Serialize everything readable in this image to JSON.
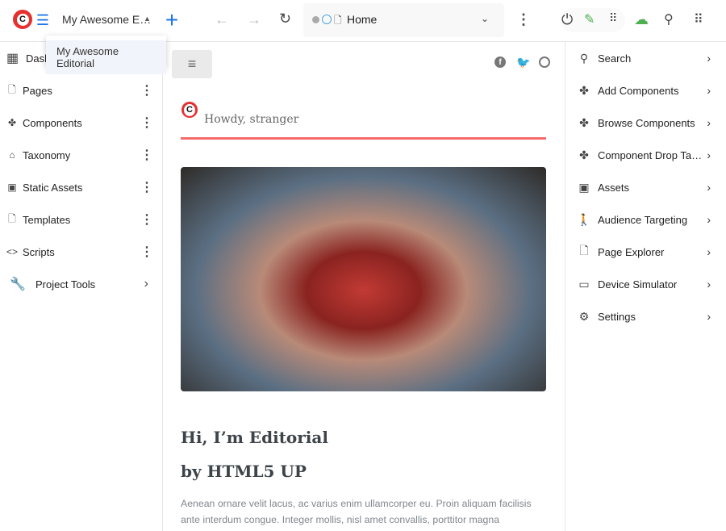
{
  "topbar": {
    "site_name": "My Awesome E…",
    "address": "Home",
    "logo_letter": "C"
  },
  "dropdown": {
    "items": [
      "My Awesome Editorial"
    ]
  },
  "left_nav": {
    "items": [
      {
        "label": "Dashboard",
        "visible_label": "Das",
        "icon": "dashboard-icon"
      },
      {
        "label": "Pages",
        "icon": "page-icon"
      },
      {
        "label": "Components",
        "icon": "puzzle-icon"
      },
      {
        "label": "Taxonomy",
        "icon": "tag-icon"
      },
      {
        "label": "Static Assets",
        "icon": "image-icon"
      },
      {
        "label": "Templates",
        "icon": "file-icon"
      },
      {
        "label": "Scripts",
        "icon": "code-icon"
      },
      {
        "label": "Project Tools",
        "icon": "wrench-icon"
      }
    ]
  },
  "right_nav": {
    "items": [
      {
        "label": "Search",
        "icon": "search-icon"
      },
      {
        "label": "Add Components",
        "icon": "puzzle-icon"
      },
      {
        "label": "Browse Components",
        "icon": "puzzle-icon"
      },
      {
        "label": "Component Drop Ta…",
        "icon": "puzzle-icon"
      },
      {
        "label": "Assets",
        "icon": "image-icon"
      },
      {
        "label": "Audience Targeting",
        "icon": "person-icon"
      },
      {
        "label": "Page Explorer",
        "icon": "page-search-icon"
      },
      {
        "label": "Device Simulator",
        "icon": "devices-icon"
      },
      {
        "label": "Settings",
        "icon": "gear-icon"
      }
    ]
  },
  "preview": {
    "greeting": "Howdy, stranger",
    "heading1": "Hi, I’m Editorial",
    "heading2": "by HTML5 UP",
    "paragraph": "Aenean ornare velit lacus, ac varius enim ullamcorper eu. Proin aliquam facilisis ante interdum congue. Integer mollis, nisl amet convallis, porttitor magna ullamcorper, amet"
  },
  "colors": {
    "accent": "#f56a6a",
    "brand": "#e53030",
    "blue": "#1a73e8",
    "green": "#4caf50"
  }
}
